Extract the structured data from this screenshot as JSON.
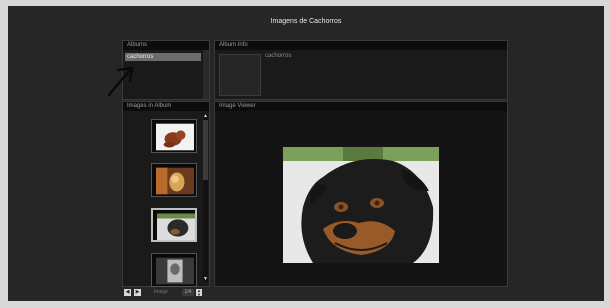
{
  "app": {
    "title": "Imagens de Cachorros"
  },
  "albums_panel": {
    "header": "Albums",
    "items": [
      {
        "label": "cachorros",
        "selected": true
      }
    ]
  },
  "album_info_panel": {
    "header": "Album Info",
    "name": "cachorros"
  },
  "images_panel": {
    "header": "Images in Album",
    "thumbnails": [
      {
        "icon": "dog-photo-1",
        "selected": false
      },
      {
        "icon": "dog-photo-2",
        "selected": false
      },
      {
        "icon": "dog-photo-3",
        "selected": true
      },
      {
        "icon": "dog-photo-4",
        "selected": false
      }
    ]
  },
  "viewer_panel": {
    "header": "Image Viewer",
    "photo_icon": "rottweiler-photo"
  },
  "pager": {
    "prev_symbol": "◀",
    "next_symbol": "▶",
    "label": "Image",
    "value": "1/4",
    "spin_up": "▲",
    "spin_down": "▼"
  },
  "annotation": {
    "icon": "hand-drawn-arrow-icon"
  }
}
